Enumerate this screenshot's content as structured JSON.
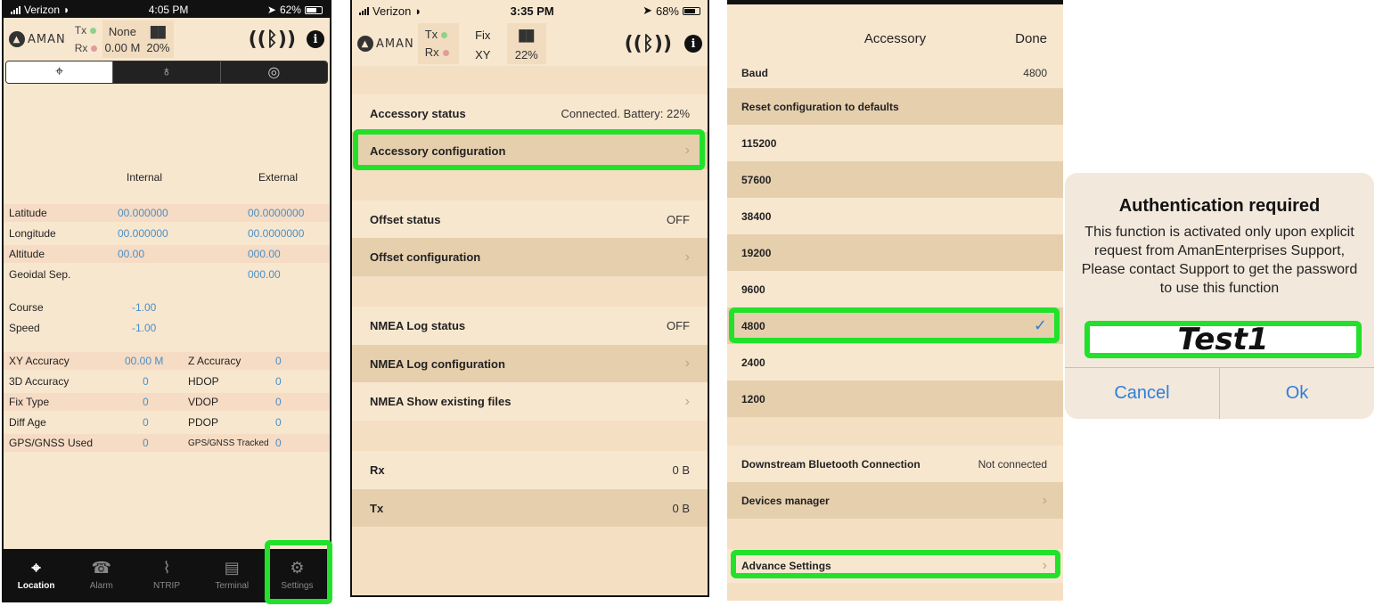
{
  "screen1": {
    "status": {
      "carrier": "Verizon",
      "time": "4:05 PM",
      "battery": "62%"
    },
    "logo": "AMAN",
    "tx_label": "Tx",
    "rx_label": "Rx",
    "fix_value": "None",
    "distance_value": "0.00 M",
    "battery_value": "20%",
    "columns": {
      "internal": "Internal",
      "external": "External"
    },
    "rows": [
      {
        "label": "Latitude",
        "internal": "00.000000",
        "external": "00.0000000"
      },
      {
        "label": "Longitude",
        "internal": "00.000000",
        "external": "00.0000000"
      },
      {
        "label": "Altitude",
        "internal": "00.00",
        "external": "000.00"
      },
      {
        "label": "Geoidal Sep.",
        "internal": "",
        "external": "000.00"
      }
    ],
    "motion": [
      {
        "label": "Course",
        "value": "-1.00"
      },
      {
        "label": "Speed",
        "value": "-1.00"
      }
    ],
    "accuracy": [
      {
        "label": "XY Accuracy",
        "value": "00.00 M",
        "label2": "Z Accuracy",
        "value2": "0"
      },
      {
        "label": "3D Accuracy",
        "value": "0",
        "label2": "HDOP",
        "value2": "0"
      },
      {
        "label": "Fix Type",
        "value": "0",
        "label2": "VDOP",
        "value2": "0"
      },
      {
        "label": "Diff Age",
        "value": "0",
        "label2": "PDOP",
        "value2": "0"
      },
      {
        "label": "GPS/GNSS Used",
        "value": "0",
        "label2": "GPS/GNSS Tracked",
        "value2": "0"
      }
    ],
    "tabbar": [
      "Location",
      "Alarm",
      "NTRIP",
      "Terminal",
      "Settings"
    ]
  },
  "screen2": {
    "status": {
      "carrier": "Verizon",
      "time": "3:35 PM",
      "battery": "68%"
    },
    "logo": "AMAN",
    "tx_label": "Tx",
    "rx_label": "Rx",
    "fix_label": "Fix",
    "xy_label": "XY",
    "battery_value": "22%",
    "rows": {
      "accessory_status": {
        "label": "Accessory status",
        "value": "Connected. Battery: 22%"
      },
      "accessory_config": "Accessory configuration",
      "offset_status": {
        "label": "Offset status",
        "value": "OFF"
      },
      "offset_config": "Offset configuration",
      "nmea_status": {
        "label": "NMEA Log status",
        "value": "OFF"
      },
      "nmea_config": "NMEA Log configuration",
      "nmea_files": "NMEA Show existing files",
      "rx": {
        "label": "Rx",
        "value": "0 B"
      },
      "tx": {
        "label": "Tx",
        "value": "0 B"
      }
    }
  },
  "screen3": {
    "title": "Accessory",
    "done": "Done",
    "baud": {
      "label": "Baud",
      "value": "4800"
    },
    "reset": "Reset configuration to defaults",
    "rates": [
      "115200",
      "57600",
      "38400",
      "19200",
      "9600",
      "4800",
      "2400",
      "1200"
    ],
    "selected_rate": "4800",
    "downstream": {
      "label": "Downstream Bluetooth Connection",
      "value": "Not connected"
    },
    "devices": "Devices manager",
    "advance": "Advance Settings"
  },
  "dialog": {
    "title": "Authentication required",
    "message": "This function is activated only upon explicit request from AmanEnterprises Support, Please contact Support to get the password to use this function",
    "password": "Test1",
    "cancel": "Cancel",
    "ok": "Ok"
  },
  "colors": {
    "highlight": "#22e12a",
    "sand": "#f8e7cf",
    "link_blue": "#4a8fc7",
    "ios_blue": "#2f7fd8"
  }
}
